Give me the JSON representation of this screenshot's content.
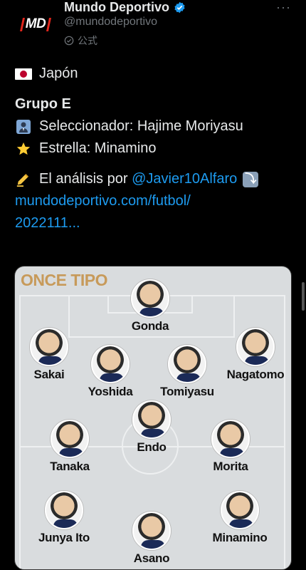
{
  "account": {
    "display_name": "Mundo Deportivo",
    "handle": "@mundodeportivo",
    "official_label": "公式",
    "logo_text": "MD"
  },
  "tweet": {
    "line1": "Japón",
    "line2": "Grupo E",
    "line3": "Seleccionador: Hajime Moriyasu",
    "line4": "Estrella: Minamino",
    "line5_prefix": "El análisis por ",
    "mention": "@Javier10Alfaro",
    "url_line1": "mundodeportivo.com/futbol/",
    "url_line2": "2022111..."
  },
  "image": {
    "title": "ONCE TIPO",
    "players": [
      {
        "name": "Gonda"
      },
      {
        "name": "Sakai"
      },
      {
        "name": "Yoshida"
      },
      {
        "name": "Tomiyasu"
      },
      {
        "name": "Nagatomo"
      },
      {
        "name": "Endo"
      },
      {
        "name": "Tanaka"
      },
      {
        "name": "Morita"
      },
      {
        "name": "Junya Ito"
      },
      {
        "name": "Minamino"
      },
      {
        "name": "Asano"
      }
    ]
  },
  "colors": {
    "background": "#000000",
    "link": "#1d9bf0",
    "secondary_text": "#71767b",
    "title_gold": "#c79a5a",
    "md_red": "#e1261c"
  },
  "icons": [
    "verified-badge-icon",
    "more-options-icon",
    "official-check-icon",
    "japan-flag-icon",
    "manager-emoji-icon",
    "star-emoji-icon",
    "writing-hand-emoji-icon",
    "down-arrow-emoji-icon"
  ]
}
